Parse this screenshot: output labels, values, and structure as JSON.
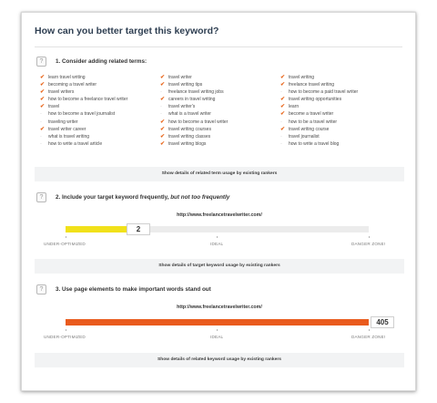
{
  "title": "How can you better target this keyword?",
  "help_glyph": "?",
  "section1": {
    "title": "1. Consider adding related terms:",
    "columns": [
      [
        {
          "text": "learn travel writing",
          "used": true
        },
        {
          "text": "becoming a travel writer",
          "used": true
        },
        {
          "text": "travel writers",
          "used": true
        },
        {
          "text": "how to become a freelance travel writer",
          "used": true
        },
        {
          "text": "travel",
          "used": true
        },
        {
          "text": "how to become a travel journalist",
          "used": false
        },
        {
          "text": "traveling writer",
          "used": false
        },
        {
          "text": "travel writer career",
          "used": true
        },
        {
          "text": "what is travel writing",
          "used": false
        },
        {
          "text": "how to write a travel article",
          "used": false
        }
      ],
      [
        {
          "text": "travel writer",
          "used": true
        },
        {
          "text": "travel writing tips",
          "used": true
        },
        {
          "text": "freelance travel writing jobs",
          "used": false
        },
        {
          "text": "careers in travel writing",
          "used": true
        },
        {
          "text": "travel writer's",
          "used": false
        },
        {
          "text": "what is a travel writer",
          "used": false
        },
        {
          "text": "how to become a travel writer",
          "used": true
        },
        {
          "text": "travel writing courses",
          "used": true
        },
        {
          "text": "travel writing classes",
          "used": true
        },
        {
          "text": "travel writing blogs",
          "used": true
        }
      ],
      [
        {
          "text": "travel writing",
          "used": true
        },
        {
          "text": "freelance travel writing",
          "used": true
        },
        {
          "text": "how to become a paid travel writer",
          "used": false
        },
        {
          "text": "travel writing opportunities",
          "used": true
        },
        {
          "text": "learn",
          "used": true
        },
        {
          "text": "become a travel writer",
          "used": true
        },
        {
          "text": "how to be a travel writer",
          "used": false
        },
        {
          "text": "travel writing course",
          "used": true
        },
        {
          "text": "travel journalist",
          "used": false
        },
        {
          "text": "how to write a travel blog",
          "used": false
        }
      ]
    ],
    "details_label": "Show details of related term usage by existing rankers"
  },
  "section2": {
    "title_prefix": "2. Include your target keyword frequently, ",
    "title_emphasis": "but not too frequently",
    "url": "http://www.freelancetravelwriter.com/",
    "value": "2",
    "fill_fraction": 0.2,
    "scale": {
      "low": "UNDER-OPTIMIZED",
      "mid": "IDEAL",
      "high": "DANGER ZONE!"
    },
    "details_label": "Show details of target keyword usage by existing rankers"
  },
  "section3": {
    "title": "3. Use page elements to make important words stand out",
    "url": "http://www.freelancetravelwriter.com/",
    "value": "405",
    "fill_fraction": 1.0,
    "scale": {
      "low": "UNDER-OPTIMIZED",
      "mid": "IDEAL",
      "high": "DANGER ZONE!"
    },
    "details_label": "Show details of related keyword usage by existing rankers"
  },
  "colors": {
    "used_mark": "#e8671c",
    "unused_mark": "#b8b8b8",
    "low_fill": "#f1e11a",
    "high_fill": "#e95b1d"
  },
  "icons": {
    "used": "checkmark-icon",
    "unused": "dot-icon",
    "help": "help-icon"
  }
}
